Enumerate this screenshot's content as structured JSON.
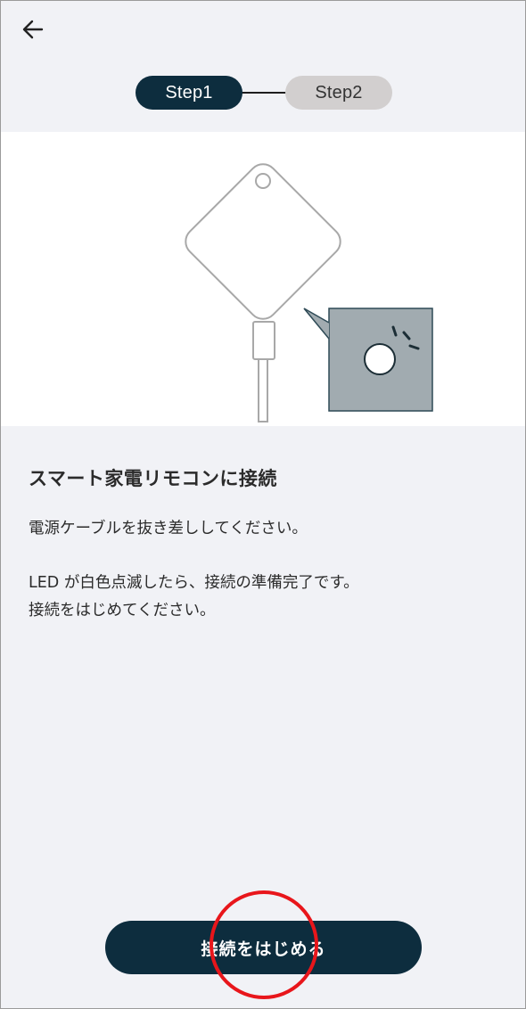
{
  "header": {
    "back_icon": "arrow-left-icon"
  },
  "stepper": {
    "steps": [
      {
        "label": "Step1",
        "state": "active"
      },
      {
        "label": "Step2",
        "state": "inactive"
      }
    ],
    "colors": {
      "active_bg": "#0d2d3e",
      "inactive_bg": "#d2cfcf"
    }
  },
  "illustration": {
    "device_icon": "smart-remote-hub-icon",
    "led_icon": "blinking-led-icon"
  },
  "content": {
    "title": "スマート家電リモコンに接続",
    "paragraph1": "電源ケーブルを抜き差ししてください。",
    "paragraph2_line1": "LED が白色点滅したら、接続の準備完了です。",
    "paragraph2_line2": "接続をはじめてください。"
  },
  "cta": {
    "label": "接続をはじめる",
    "color": "#0d2d3e"
  },
  "annotation": {
    "highlight_color": "#e8161b"
  }
}
